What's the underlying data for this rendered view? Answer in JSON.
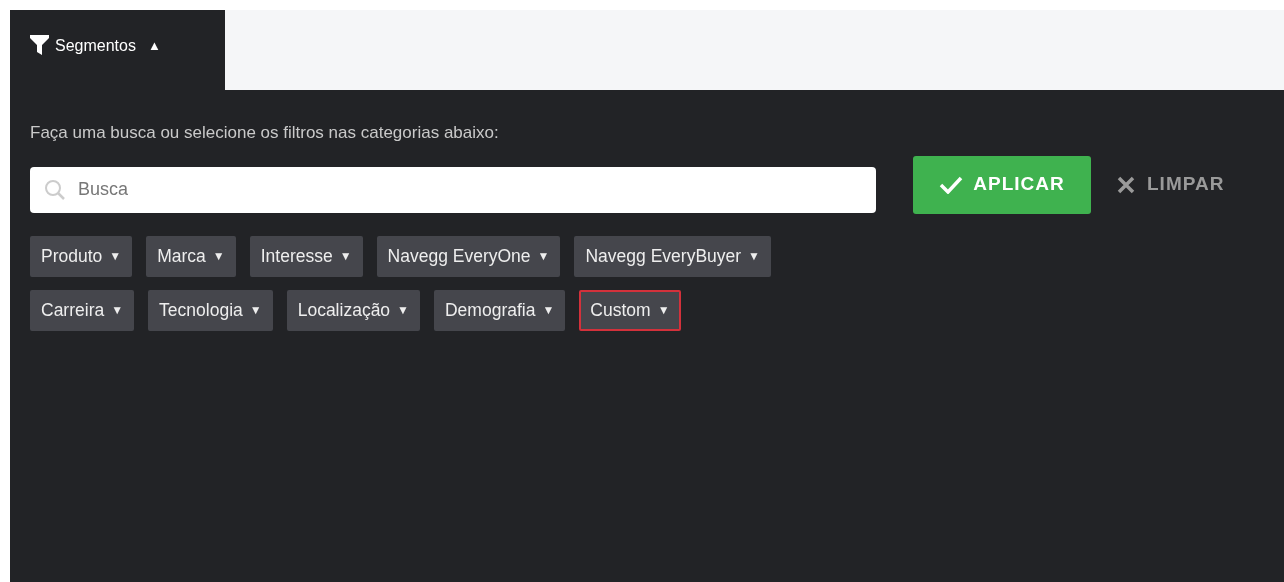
{
  "tab": {
    "label": "Segmentos",
    "arrow": "▲",
    "expanded": true
  },
  "instructions": "Faça uma busca ou selecione os filtros nas categorias abaixo:",
  "search": {
    "placeholder": "Busca"
  },
  "buttons": [
    {
      "kind": "apply",
      "label": "APLICAR"
    },
    {
      "kind": "clear",
      "label": "LIMPAR"
    }
  ],
  "categories": [
    {
      "label": "Produto",
      "arrow": "▼",
      "highlighted": false
    },
    {
      "label": "Marca",
      "arrow": "▼",
      "highlighted": false
    },
    {
      "label": "Interesse",
      "arrow": "▼",
      "highlighted": false
    },
    {
      "label": "Navegg EveryOne",
      "arrow": "▼",
      "highlighted": false
    },
    {
      "label": "Navegg EveryBuyer",
      "arrow": "▼",
      "highlighted": false
    },
    {
      "label": "Carreira",
      "arrow": "▼",
      "highlighted": false
    },
    {
      "label": "Tecnologia",
      "arrow": "▼",
      "highlighted": false
    },
    {
      "label": "Localização",
      "arrow": "▼",
      "highlighted": false
    },
    {
      "label": "Demografia",
      "arrow": "▼",
      "highlighted": false
    },
    {
      "label": "Custom",
      "arrow": "▼",
      "highlighted": true
    }
  ]
}
